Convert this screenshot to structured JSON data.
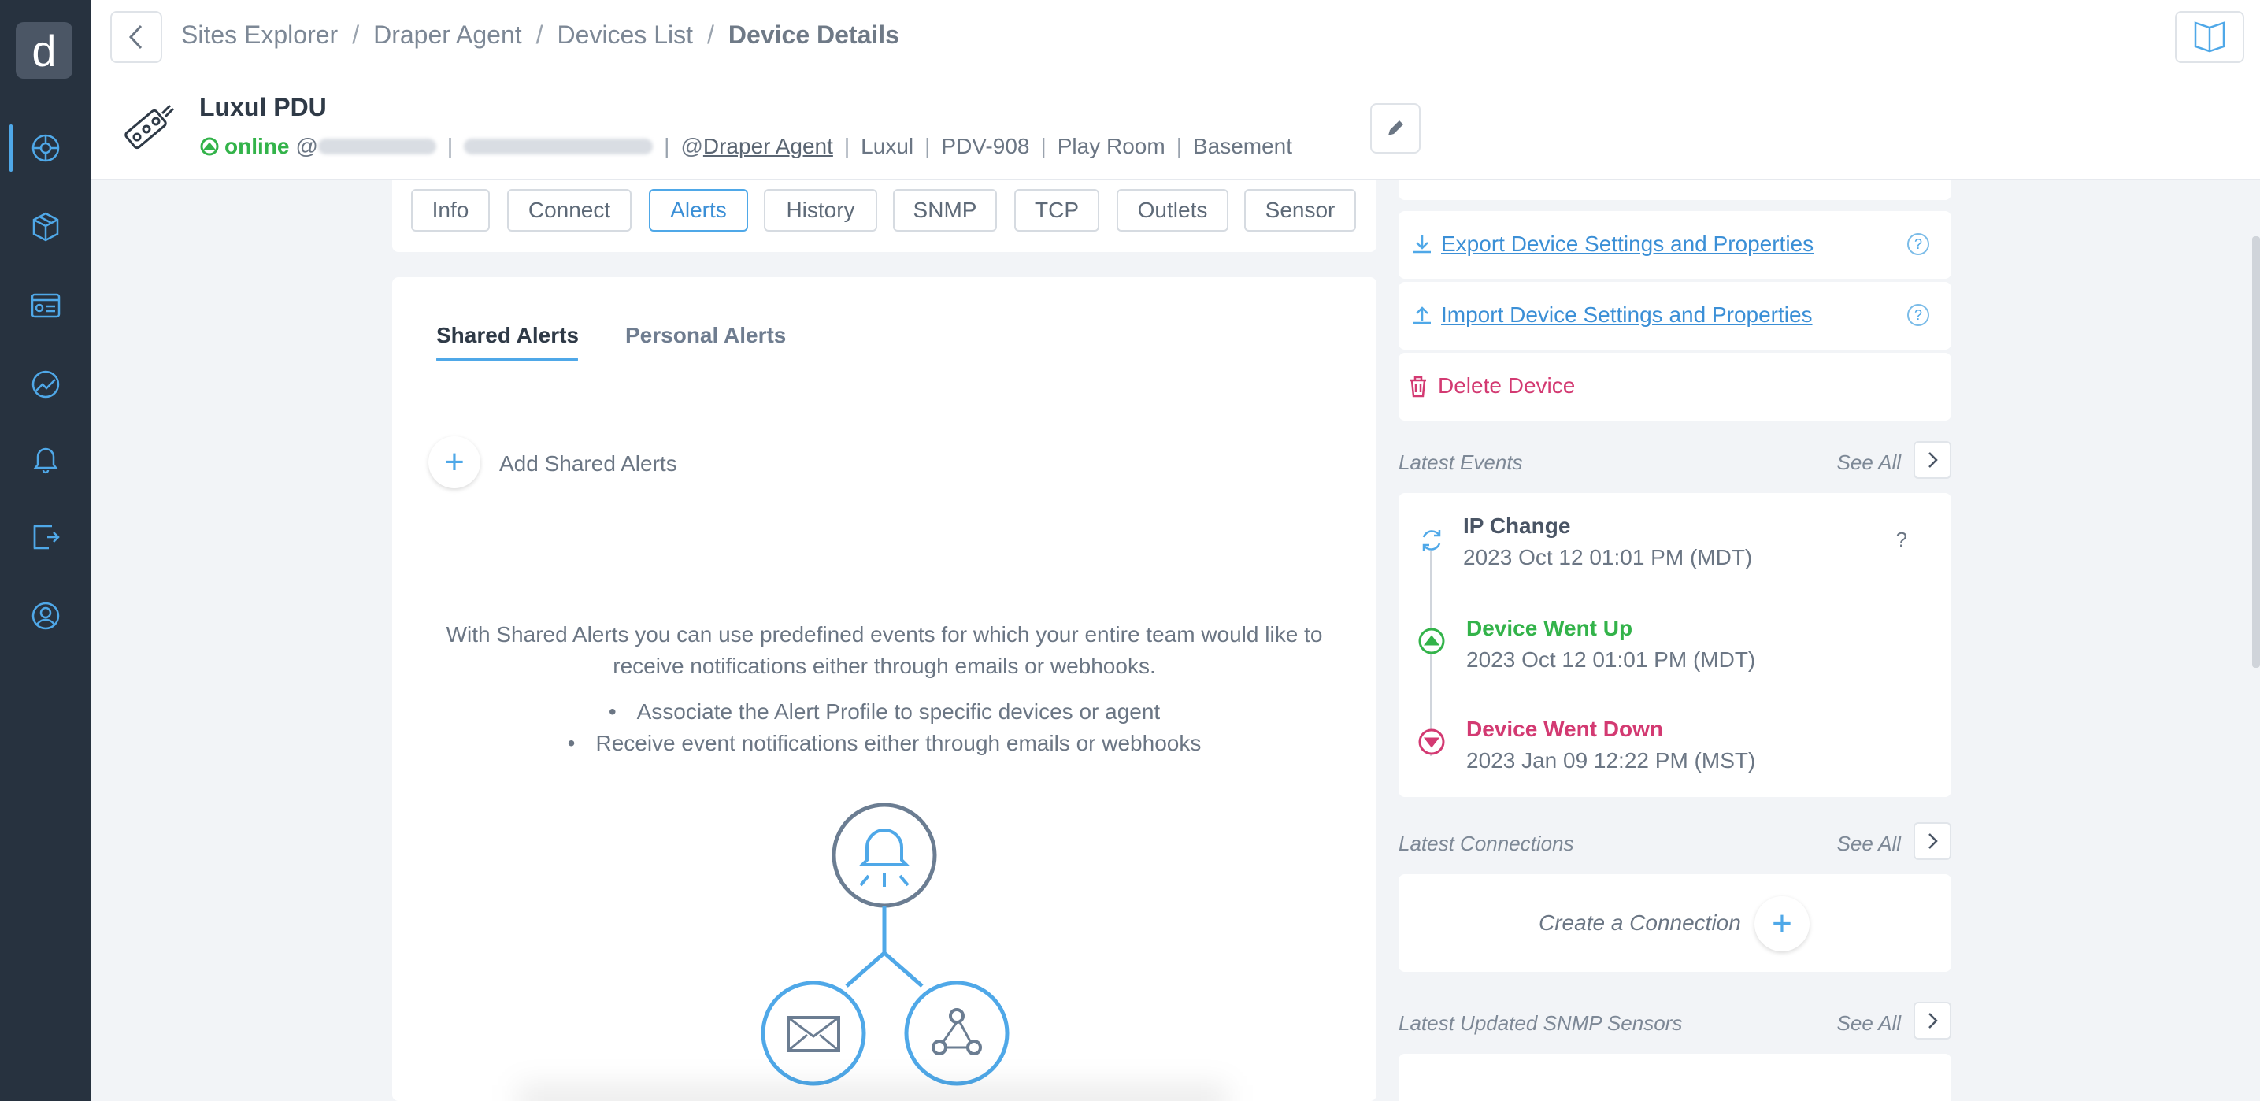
{
  "sidebar": {
    "logo": "d",
    "items": [
      {
        "icon": "network-globe-icon",
        "active": true
      },
      {
        "icon": "cube-icon",
        "active": false
      },
      {
        "icon": "dashboard-list-icon",
        "active": false
      },
      {
        "icon": "chart-circle-icon",
        "active": false
      },
      {
        "icon": "bell-icon",
        "active": false
      },
      {
        "icon": "document-share-icon",
        "active": false
      },
      {
        "icon": "user-circle-icon",
        "active": false
      }
    ]
  },
  "header": {
    "breadcrumb": [
      "Sites Explorer",
      "Draper Agent",
      "Devices List",
      "Device Details"
    ],
    "separator": "/",
    "device_name": "Luxul PDU",
    "status": "online",
    "at_sign": "@",
    "agent_prefix": "@",
    "agent": "Draper Agent",
    "brand": "Luxul",
    "model": "PDV-908",
    "room": "Play Room",
    "floor": "Basement",
    "divider": "|"
  },
  "tabs": [
    "Info",
    "Connect",
    "Alerts",
    "History",
    "SNMP",
    "TCP",
    "Outlets",
    "Sensor"
  ],
  "active_tab": "Alerts",
  "alerts": {
    "sub_tabs": [
      "Shared Alerts",
      "Personal Alerts"
    ],
    "add_label": "Add Shared Alerts",
    "add_symbol": "+",
    "description": "With Shared Alerts you can use predefined events for which your entire team would like to receive notifications either through emails or webhooks.",
    "bullets": [
      "Associate the Alert Profile to specific devices or agent",
      "Receive event notifications either through emails or webhooks"
    ]
  },
  "right": {
    "export_label": "Export Device Settings and Properties",
    "import_label": "Import Device Settings and Properties",
    "help_symbol": "?",
    "delete_label": "Delete Device",
    "latest_events_title": "Latest Events",
    "see_all": "See All",
    "events": [
      {
        "title": "IP Change",
        "time": "2023 Oct 12 01:01 PM (MDT)",
        "color": "#6f7d90",
        "extra": "?"
      },
      {
        "title": "Device Went Up",
        "time": "2023 Oct 12 01:01 PM (MDT)",
        "color": "#33b34a"
      },
      {
        "title": "Device Went Down",
        "time": "2023 Jan 09 12:22 PM (MST)",
        "color": "#d33a72"
      }
    ],
    "latest_connections_title": "Latest Connections",
    "create_connection": "Create a Connection",
    "latest_snmp_title": "Latest Updated SNMP Sensors"
  },
  "colors": {
    "accent": "#4fa8e8",
    "online": "#33b34a",
    "danger": "#d33a72",
    "sidebar": "#27323f"
  }
}
